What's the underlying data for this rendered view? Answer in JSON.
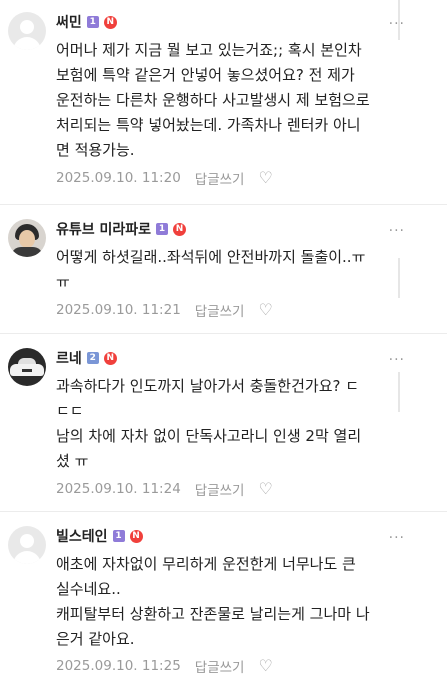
{
  "comments": [
    {
      "author": "써민",
      "level": "1",
      "badge": "N",
      "more": "···",
      "text": "어머나 제가 지금 뭘 보고 있는거죠;; 혹시 본인차\n보험에 특약 같은거 안넣어 놓으셨어요? 전 제가\n운전하는 다른차 운행하다 사고발생시 제 보험으로\n처리되는 특약 넣어놨는데. 가족차나 렌터카 아니\n면 적용가능.",
      "date": "2025.09.10. 11:20",
      "reply": "답글쓰기",
      "like_icon": "heart-outline-icon"
    },
    {
      "author": "유튜브 미라파로",
      "level": "1",
      "badge": "N",
      "more": "···",
      "text": "어떻게 하셧길래..좌석뒤에 안전바까지 돌출이..ㅠ\nㅠ",
      "date": "2025.09.10. 11:21",
      "reply": "답글쓰기",
      "like_icon": "heart-outline-icon"
    },
    {
      "author": "르네",
      "level": "2",
      "badge": "N",
      "more": "···",
      "text": "과속하다가 인도까지 날아가서 충돌한건가요? ㄷ\nㄷㄷ\n남의 차에 자차 없이 단독사고라니 인생 2막 열리\n셨 ㅠ",
      "date": "2025.09.10. 11:24",
      "reply": "답글쓰기",
      "like_icon": "heart-outline-icon"
    },
    {
      "author": "빌스테인",
      "level": "1",
      "badge": "N",
      "more": "···",
      "text": "애초에 자차없이 무리하게 운전한게 너무나도 큰\n실수네요..\n캐피탈부터 상환하고 잔존물로 날리는게 그나마 나\n은거 같아요.",
      "date": "2025.09.10. 11:25",
      "reply": "답글쓰기",
      "like_icon": "heart-outline-icon"
    }
  ]
}
